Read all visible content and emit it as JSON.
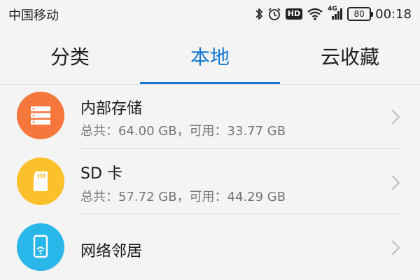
{
  "status_bar": {
    "carrier": "中国移动",
    "network_label": "4G",
    "hd_label": "HD",
    "battery_level": "80",
    "time": "00:18"
  },
  "tabs": [
    {
      "label": "分类",
      "active": false
    },
    {
      "label": "本地",
      "active": true
    },
    {
      "label": "云收藏",
      "active": false
    }
  ],
  "accent_color": "#1677d2",
  "storage_items": [
    {
      "title": "内部存储",
      "subtitle": "总共：64.00 GB，可用：33.77 GB",
      "icon": "storage-icon",
      "icon_color": "#f5773b"
    },
    {
      "title": "SD 卡",
      "subtitle": "总共：57.72 GB，可用：44.29 GB",
      "icon": "sd-card-icon",
      "icon_color": "#fcc02d"
    },
    {
      "title": "网络邻居",
      "subtitle": "",
      "icon": "network-phone-icon",
      "icon_color": "#29b6e8"
    }
  ]
}
